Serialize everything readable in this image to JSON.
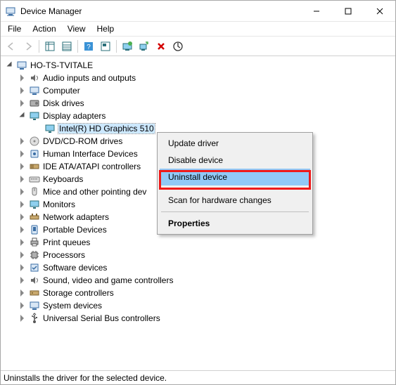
{
  "window": {
    "title": "Device Manager"
  },
  "menubar": [
    "File",
    "Action",
    "View",
    "Help"
  ],
  "status": "Uninstalls the driver for the selected device.",
  "tree": {
    "root": "HO-TS-TVITALE",
    "display_adapters_label": "Display adapters",
    "selected_device": "Intel(R) HD Graphics 510",
    "categories": [
      "Audio inputs and outputs",
      "Computer",
      "Disk drives",
      "DVD/CD-ROM drives",
      "Human Interface Devices",
      "IDE ATA/ATAPI controllers",
      "Keyboards",
      "Mice and other pointing dev",
      "Monitors",
      "Network adapters",
      "Portable Devices",
      "Print queues",
      "Processors",
      "Software devices",
      "Sound, video and game controllers",
      "Storage controllers",
      "System devices",
      "Universal Serial Bus controllers"
    ]
  },
  "context_menu": {
    "update": "Update driver",
    "disable": "Disable device",
    "uninstall": "Uninstall device",
    "scan": "Scan for hardware changes",
    "properties": "Properties"
  }
}
